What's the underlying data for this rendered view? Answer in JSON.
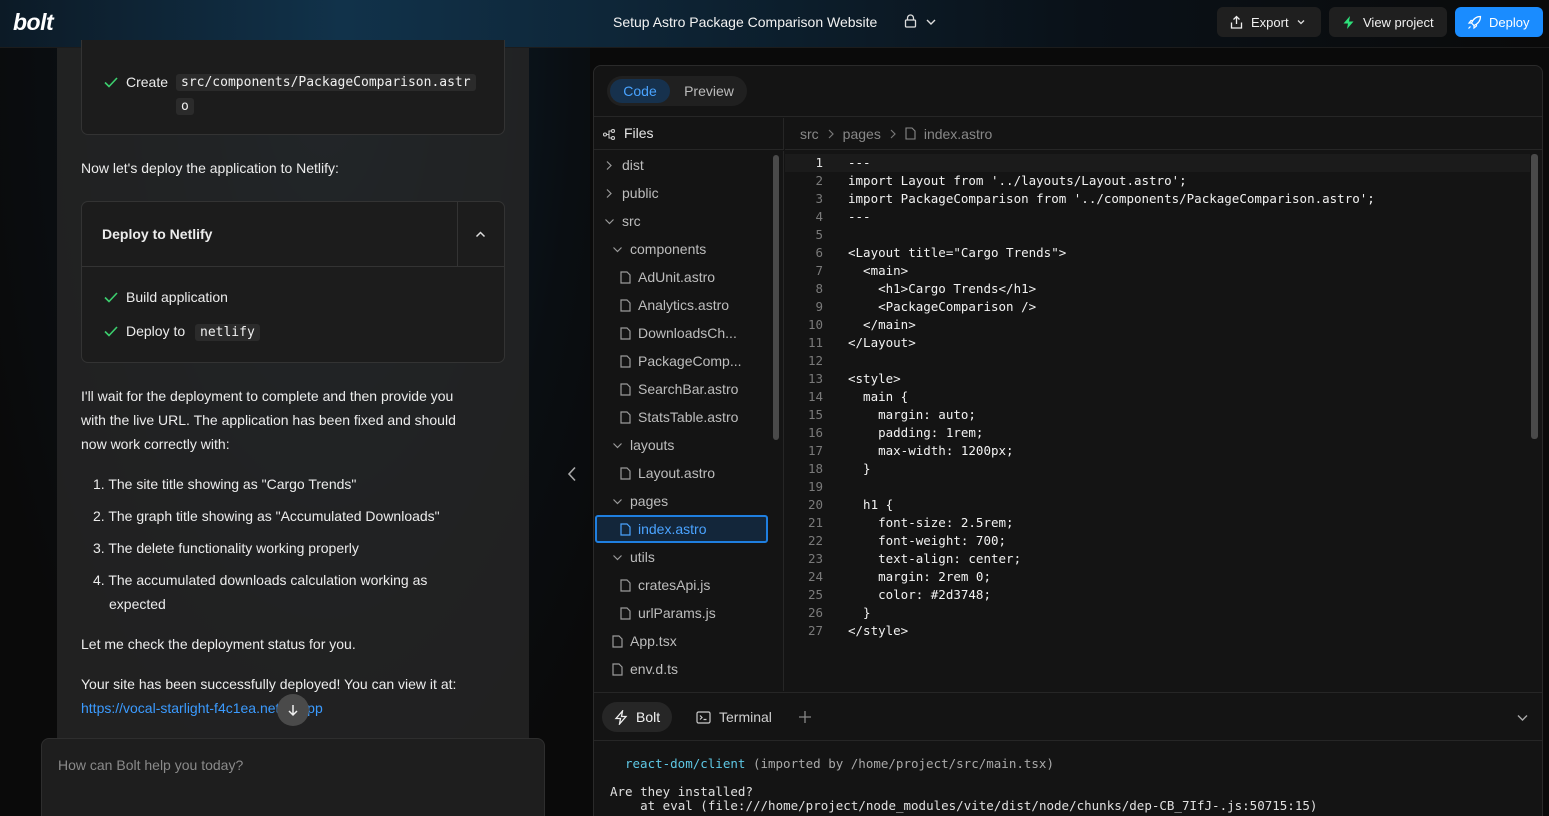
{
  "app": {
    "logo": "bolt",
    "project_title": "Setup Astro Package Comparison Website",
    "export_label": "Export",
    "view_project_label": "View project",
    "deploy_label": "Deploy"
  },
  "chat": {
    "create_step": {
      "prefix": "Create",
      "path_line1": "src/components/PackageComparison.astr",
      "path_line2": "o"
    },
    "intro_deploy": "Now let's deploy the application to Netlify:",
    "deploy_card": {
      "title": "Deploy to Netlify",
      "steps": [
        {
          "label": "Build application",
          "code": ""
        },
        {
          "label": "Deploy to",
          "code": "netlify"
        }
      ]
    },
    "wait_paragraph_lines": [
      "I'll wait for the deployment to complete and then provide you",
      "with the live URL. The application has been fixed and should",
      "now work correctly with:"
    ],
    "list_items": [
      "1. The site title showing as \"Cargo Trends\"",
      "2. The graph title showing as \"Accumulated Downloads\"",
      "3. The delete functionality working properly",
      "4. The accumulated downloads calculation working as",
      "expected"
    ],
    "check_status": "Let me check the deployment status for you.",
    "deployed_text": "Your site has been successfully deployed! You can view it at:",
    "deployed_link": "https://vocal-starlight-f4c1ea.netlify.app",
    "prompt_placeholder": "How can Bolt help you today?"
  },
  "workbench": {
    "tabs": {
      "code": "Code",
      "preview": "Preview"
    },
    "files_label": "Files",
    "breadcrumb": [
      "src",
      "pages",
      "index.astro"
    ],
    "tree": [
      {
        "name": "dist",
        "type": "folder-closed",
        "depth": 0
      },
      {
        "name": "public",
        "type": "folder-closed",
        "depth": 0
      },
      {
        "name": "src",
        "type": "folder-open",
        "depth": 0
      },
      {
        "name": "components",
        "type": "folder-open",
        "depth": 1
      },
      {
        "name": "AdUnit.astro",
        "type": "file",
        "depth": 2
      },
      {
        "name": "Analytics.astro",
        "type": "file",
        "depth": 2
      },
      {
        "name": "DownloadsCh...",
        "type": "file",
        "depth": 2
      },
      {
        "name": "PackageComp...",
        "type": "file",
        "depth": 2
      },
      {
        "name": "SearchBar.astro",
        "type": "file",
        "depth": 2
      },
      {
        "name": "StatsTable.astro",
        "type": "file",
        "depth": 2
      },
      {
        "name": "layouts",
        "type": "folder-open",
        "depth": 1
      },
      {
        "name": "Layout.astro",
        "type": "file",
        "depth": 2
      },
      {
        "name": "pages",
        "type": "folder-open",
        "depth": 1
      },
      {
        "name": "index.astro",
        "type": "file",
        "depth": 2,
        "selected": true
      },
      {
        "name": "utils",
        "type": "folder-open",
        "depth": 1
      },
      {
        "name": "cratesApi.js",
        "type": "file",
        "depth": 2
      },
      {
        "name": "urlParams.js",
        "type": "file",
        "depth": 2
      },
      {
        "name": "App.tsx",
        "type": "file",
        "depth": 1
      },
      {
        "name": "env.d.ts",
        "type": "file",
        "depth": 1
      }
    ],
    "code_lines": [
      "---",
      "import Layout from '../layouts/Layout.astro';",
      "import PackageComparison from '../components/PackageComparison.astro';",
      "---",
      "",
      "<Layout title=\"Cargo Trends\">",
      "  <main>",
      "    <h1>Cargo Trends</h1>",
      "    <PackageComparison />",
      "  </main>",
      "</Layout>",
      "",
      "<style>",
      "  main {",
      "    margin: auto;",
      "    padding: 1rem;",
      "    max-width: 1200px;",
      "  }",
      "",
      "  h1 {",
      "    font-size: 2.5rem;",
      "    font-weight: 700;",
      "    text-align: center;",
      "    margin: 2rem 0;",
      "    color: #2d3748;",
      "  }",
      "</style>"
    ],
    "active_line": 1,
    "bottom_tabs": {
      "bolt": "Bolt",
      "terminal": "Terminal"
    },
    "terminal": {
      "line1_module": "react-dom/client",
      "line1_rest": " (imported by /home/project/src/main.tsx)",
      "line2": "Are they installed?",
      "line3": "    at eval (file:///home/project/node_modules/vite/dist/node/chunks/dep-CB_7IfJ-.js:50715:15)"
    }
  },
  "colors": {
    "accent": "#1a8cff",
    "link": "#3b9bff",
    "check": "#3ccf6e",
    "view_project_bolt": "#2ee07a"
  }
}
